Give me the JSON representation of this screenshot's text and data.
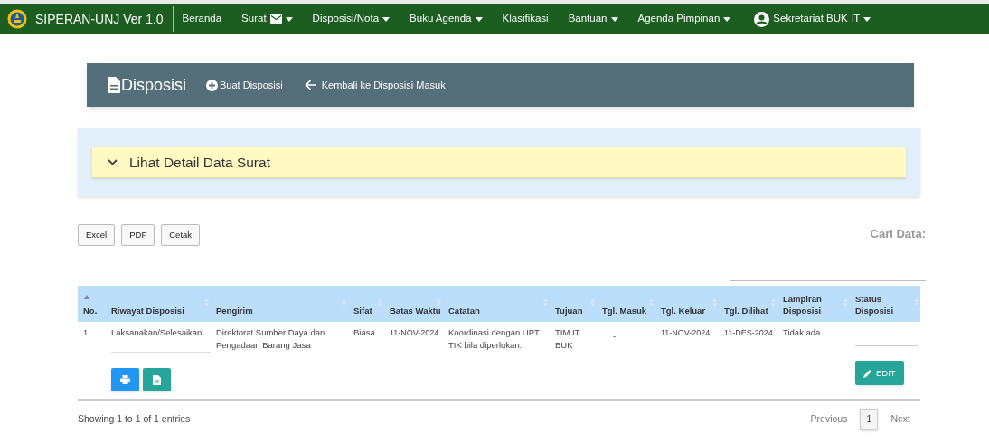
{
  "navbar": {
    "brand": "SIPERAN-UNJ Ver 1.0",
    "items": [
      {
        "label": "Beranda",
        "kind": "link"
      },
      {
        "label": "Surat",
        "kind": "maildropdown"
      },
      {
        "label": "Disposisi/Nota",
        "kind": "dropdown"
      },
      {
        "label": "Buku Agenda",
        "kind": "dropdown"
      },
      {
        "label": "Klasifikasi",
        "kind": "link"
      },
      {
        "label": "Bantuan",
        "kind": "dropdown"
      },
      {
        "label": "Agenda Pimpinan",
        "kind": "dropdown"
      }
    ],
    "user": {
      "label": "Sekretariat BUK IT",
      "kind": "dropdown"
    }
  },
  "header": {
    "title": "Disposisi",
    "create_link": "Buat Disposisi",
    "back_link": "Kembali ke Disposisi Masuk"
  },
  "detail_panel": {
    "label": "Lihat Detail Data Surat",
    "expanded": false
  },
  "export_buttons": [
    "Excel",
    "PDF",
    "Cetak"
  ],
  "search": {
    "label": "Cari Data:"
  },
  "table": {
    "columns": [
      {
        "label": "No.",
        "sorted": true
      },
      {
        "label": "Riwayat Disposisi",
        "sorted": false
      },
      {
        "label": "Pengirim",
        "sorted": false
      },
      {
        "label": "Sifat",
        "sorted": false
      },
      {
        "label": "Batas Waktu",
        "sorted": false
      },
      {
        "label": "Catatan",
        "sorted": false
      },
      {
        "label": "Tujuan",
        "sorted": false
      },
      {
        "label": "Tgl. Masuk",
        "sorted": false
      },
      {
        "label": "Tgl. Keluar",
        "sorted": false
      },
      {
        "label": "Tgl. Dilihat",
        "sorted": false
      },
      {
        "label": "Lampiran Disposisi",
        "sorted": false
      },
      {
        "label": "Status Disposisi",
        "sorted": false
      }
    ],
    "rows": [
      {
        "cells": [
          "1",
          "Laksanakan/Selesaikan",
          "Direktorat Sumber Daya dan Pengadaan Barang Jasa",
          "Biasa",
          "11-NOV-2024",
          "Koordinasi dengan UPT TIK bila diperlukan.",
          "TIM IT BUK",
          "-",
          "11-NOV-2024",
          "11-DES-2024",
          "Tidak ada"
        ],
        "edit_label": "EDIT"
      }
    ]
  },
  "footer": {
    "info": "Showing 1 to 1 of 1 entries",
    "previous": "Previous",
    "pages": [
      {
        "label": "1",
        "selected": true
      }
    ],
    "next": "Next"
  }
}
